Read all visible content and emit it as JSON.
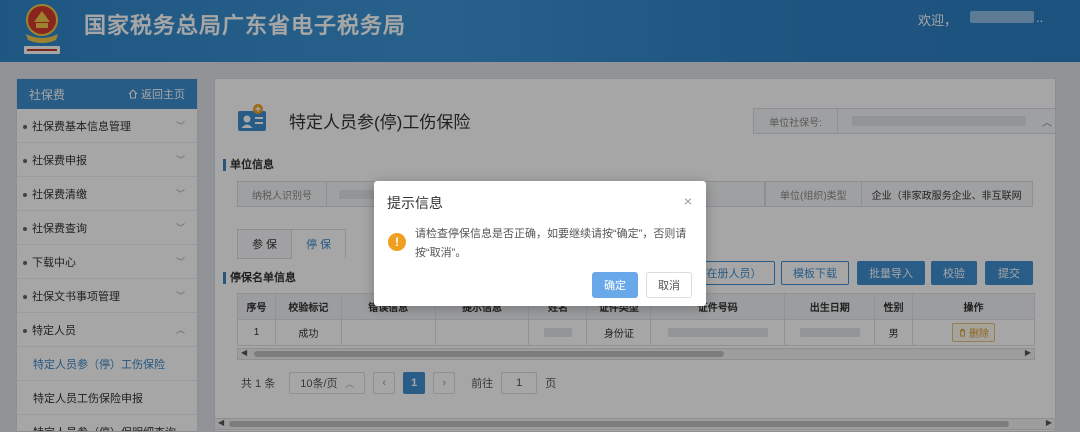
{
  "header": {
    "title": "国家税务总局广东省电子税务局",
    "welcome": "欢迎，",
    "welcome_suffix": ".."
  },
  "sidebar": {
    "section": "社保费",
    "home_label": "返回主页",
    "items": [
      {
        "label": "社保费基本信息管理"
      },
      {
        "label": "社保费申报"
      },
      {
        "label": "社保费清缴"
      },
      {
        "label": "社保费查询"
      },
      {
        "label": "下载中心"
      },
      {
        "label": "社保文书事项管理"
      },
      {
        "label": "特定人员"
      }
    ],
    "sub_items": [
      {
        "label": "特定人员参（停）工伤保险",
        "active": true
      },
      {
        "label": "特定人员工伤保险申报"
      },
      {
        "label": "特定人员参（停）保明细查询"
      }
    ]
  },
  "main": {
    "title": "特定人员参(停)工伤保险",
    "unit_social_no_label": "单位社保号:",
    "unit_info_title": "单位信息",
    "taxpayer_id_label": "纳税人识别号",
    "unit_type_label": "单位(组织)类型",
    "unit_type_value": "企业（非家政服务企业、非互联网",
    "tabs": [
      {
        "label": "参 保"
      },
      {
        "label": "停 保",
        "active": true
      }
    ],
    "list_title": "停保名单信息",
    "buttons": {
      "registered_suffix": "在册人员）",
      "template_download": "模板下载",
      "batch_import": "批量导入",
      "validate": "校验",
      "submit": "提交"
    },
    "table": {
      "headers": [
        "序号",
        "校验标记",
        "错误信息",
        "提示信息",
        "姓名",
        "证件类型",
        "证件号码",
        "出生日期",
        "性别",
        "操作"
      ],
      "rows": [
        {
          "index": "1",
          "status": "成功",
          "id_type": "身份证",
          "gender": "男",
          "action": "删除"
        }
      ]
    },
    "pagination": {
      "total": "共 1 条",
      "page_size": "10条/页",
      "current_page": "1",
      "goto_label": "前往",
      "goto_value": "1",
      "page_unit": "页"
    }
  },
  "dialog": {
    "title": "提示信息",
    "message": "请检查停保信息是否正确，如要继续请按“确定”，否则请按“取消”。",
    "ok_label": "确定",
    "cancel_label": "取消"
  },
  "colors": {
    "header_blue": "#3d95d6",
    "accent": "#3f8fd2",
    "success": "#54a843",
    "warning": "#f0a020"
  }
}
